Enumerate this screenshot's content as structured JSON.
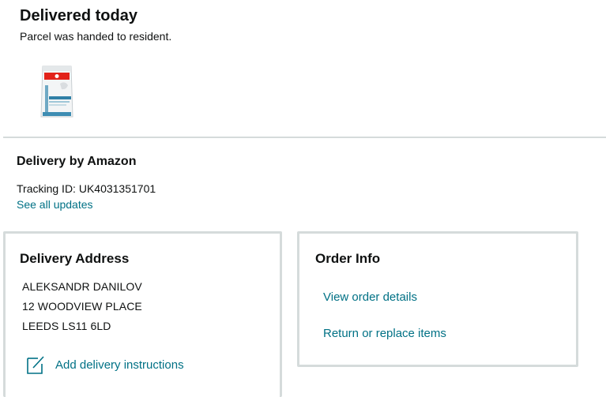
{
  "delivery_status": {
    "title": "Delivered today",
    "subtitle": "Parcel was handed to resident."
  },
  "product": {
    "image_alt": "Royal Canin dog food bag"
  },
  "carrier": {
    "title": "Delivery by Amazon",
    "tracking_label": "Tracking ID: UK4031351701",
    "see_all_updates": "See all updates"
  },
  "delivery_address": {
    "title": "Delivery Address",
    "lines": [
      "ALEKSANDR DANILOV",
      "12 WOODVIEW PLACE",
      "LEEDS LS11 6LD"
    ],
    "instructions_link": "Add delivery instructions",
    "instructions_icon": "edit-note-icon"
  },
  "order_info": {
    "title": "Order Info",
    "view_details": "View order details",
    "return_replace": "Return or replace items"
  },
  "colors": {
    "link": "#007185",
    "text": "#0f1111",
    "border": "#d5dbdb"
  }
}
